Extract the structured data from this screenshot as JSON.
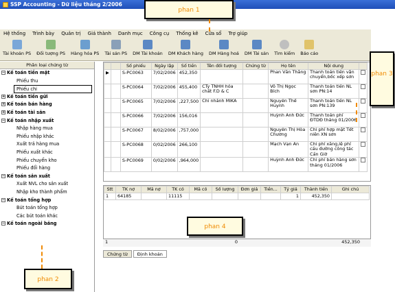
{
  "window": {
    "title": "SSP Accounting - Dữ liệu tháng 2/2006"
  },
  "menu": [
    "Hệ thống",
    "Trình bày",
    "Quản trị",
    "Giá thành",
    "Danh mục",
    "Công cụ",
    "Thống kê",
    "Cửa sổ",
    "Trợ giúp"
  ],
  "toolbar": [
    "Tài khoản PS",
    "Đối tượng PS",
    "Hàng hóa PS",
    "Tài sản PS",
    "DM Tài khoản",
    "DM Khách hàng",
    "DM Hàng hoá",
    "DM Tài sản",
    "Tìm kiếm",
    "Báo cáo"
  ],
  "left": {
    "header": "Phân loại chứng từ",
    "items": [
      "Kế toán tiền mặt",
      "Phiếu thu",
      "Phiếu chi",
      "Kế toán tiền gửi",
      "Kế toán bán hàng",
      "Kế toán tài sản",
      "Kế toán nhập xuất",
      "Nhập hàng mua",
      "Phiếu nhập khác",
      "Xuất trả hàng mua",
      "Phiếu xuất khác",
      "Phiếu chuyển kho",
      "Phiếu đổi hàng",
      "Kế toán sản xuất",
      "Xuất NVL cho sản xuất",
      "Nhập kho thành phẩm",
      "Kế toán tổng hợp",
      "Bút toán tổng hợp",
      "Các bút toán khác",
      "Kế toán ngoài bảng"
    ]
  },
  "grid": {
    "cols": [
      "Số phiếu",
      "Ngày lập",
      "Số tiền",
      "Tên đối tượng",
      "Chứng từ",
      "Họ tên",
      "Nội dung"
    ],
    "rows": [
      [
        "S-PC0063",
        "7/02/2006",
        "452,350",
        "",
        "",
        "Phan Văn Thắng",
        "Thanh toán tiền vận chuyển,bốc xếp sơn"
      ],
      [
        "S-PC0064",
        "7/02/2006",
        "455,400",
        "CTy TNHH hóa chất F.D & C",
        "",
        "Võ Thị Ngọc Bích",
        "Thanh toán tiền NL sơn PN:14"
      ],
      [
        "S-PC0065",
        "7/02/2006",
        ",227,500",
        "Chi nhánh MIKA",
        "",
        "Nguyễn Thế Huynh",
        "Thanh toán tiền NL sơn PN:139"
      ],
      [
        "S-PC0066",
        "7/02/2006",
        "156,016",
        "",
        "",
        "Huỳnh Anh Đức",
        "Thanh toán phí ĐTDĐ tháng 01/2006"
      ],
      [
        "S-PC0067",
        "8/02/2006",
        ",757,000",
        "",
        "",
        "Nguyễn Thị Hòa Chương",
        "Chi phí hợp mặt Tết niên XN sơn"
      ],
      [
        "S-PC0068",
        "0/02/2006",
        "266,100",
        "",
        "",
        "Mạch Vạn Ân",
        "Chi phí xăng,lệ phí cầu đường công tác Cần Giờ"
      ],
      [
        "S-PC0069",
        "0/02/2006",
        ",964,000",
        "",
        "",
        "Huỳnh Anh Đức",
        "Chi phí bán hàng sơn tháng 01/2006"
      ]
    ]
  },
  "detail": {
    "cols": [
      "Stt",
      "TK nợ",
      "Mã nợ",
      "TK có",
      "Mã có",
      "Số lượng",
      "Đơn giá",
      "Tiền...",
      "Tỷ giá",
      "Thành tiền",
      "Ghi chú"
    ],
    "row": [
      "1",
      "64185",
      "",
      "11115",
      "",
      "",
      "",
      "",
      "1",
      "452,350",
      ""
    ],
    "summary": [
      "1",
      "0",
      "452,350"
    ]
  },
  "tabs": [
    "Chứng từ",
    "Định khoản"
  ],
  "callouts": [
    "phan 1",
    "phan 2",
    "phan 3",
    "phan 4"
  ]
}
